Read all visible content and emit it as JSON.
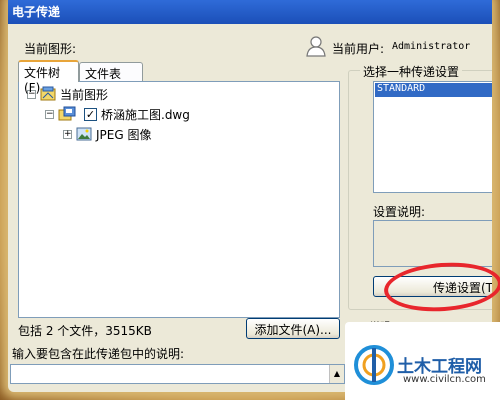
{
  "window": {
    "title": "电子传递"
  },
  "current_drawing_label": "当前图形:",
  "current_user": {
    "label": "当前用户:",
    "name": "Administrator",
    "icon": "user-icon"
  },
  "tabs": [
    {
      "label": "文件树(F)",
      "active": true
    },
    {
      "label": "文件表(B)",
      "active": false
    }
  ],
  "tree": [
    {
      "label": "当前图形",
      "icon": "drawing-set-icon",
      "expander": "−"
    },
    {
      "label": "桥涵施工图.dwg",
      "icon": "dwg-file-icon",
      "expander": "−",
      "checked": true
    },
    {
      "label": "JPEG 图像",
      "icon": "image-icon",
      "expander": "+"
    }
  ],
  "file_summary": "包括 2 个文件，3515KB",
  "add_file_button": "添加文件(A)...",
  "notes_label": "输入要包含在此传递包中的说明:",
  "transmittal_setups": {
    "group_title": "选择一种传递设置",
    "items": [
      "STANDARD"
    ],
    "selected": "STANDARD"
  },
  "setup_description_label": "设置说明:",
  "transmittal_setups_button": "传递设置(T",
  "partial_label": "说明",
  "watermark": {
    "title": "土木工程网",
    "url": "www.civilcn.com"
  },
  "colors": {
    "annotation_ring": "#e8262c",
    "selection": "#316ac5",
    "title_bar": "#2f6bd8"
  }
}
